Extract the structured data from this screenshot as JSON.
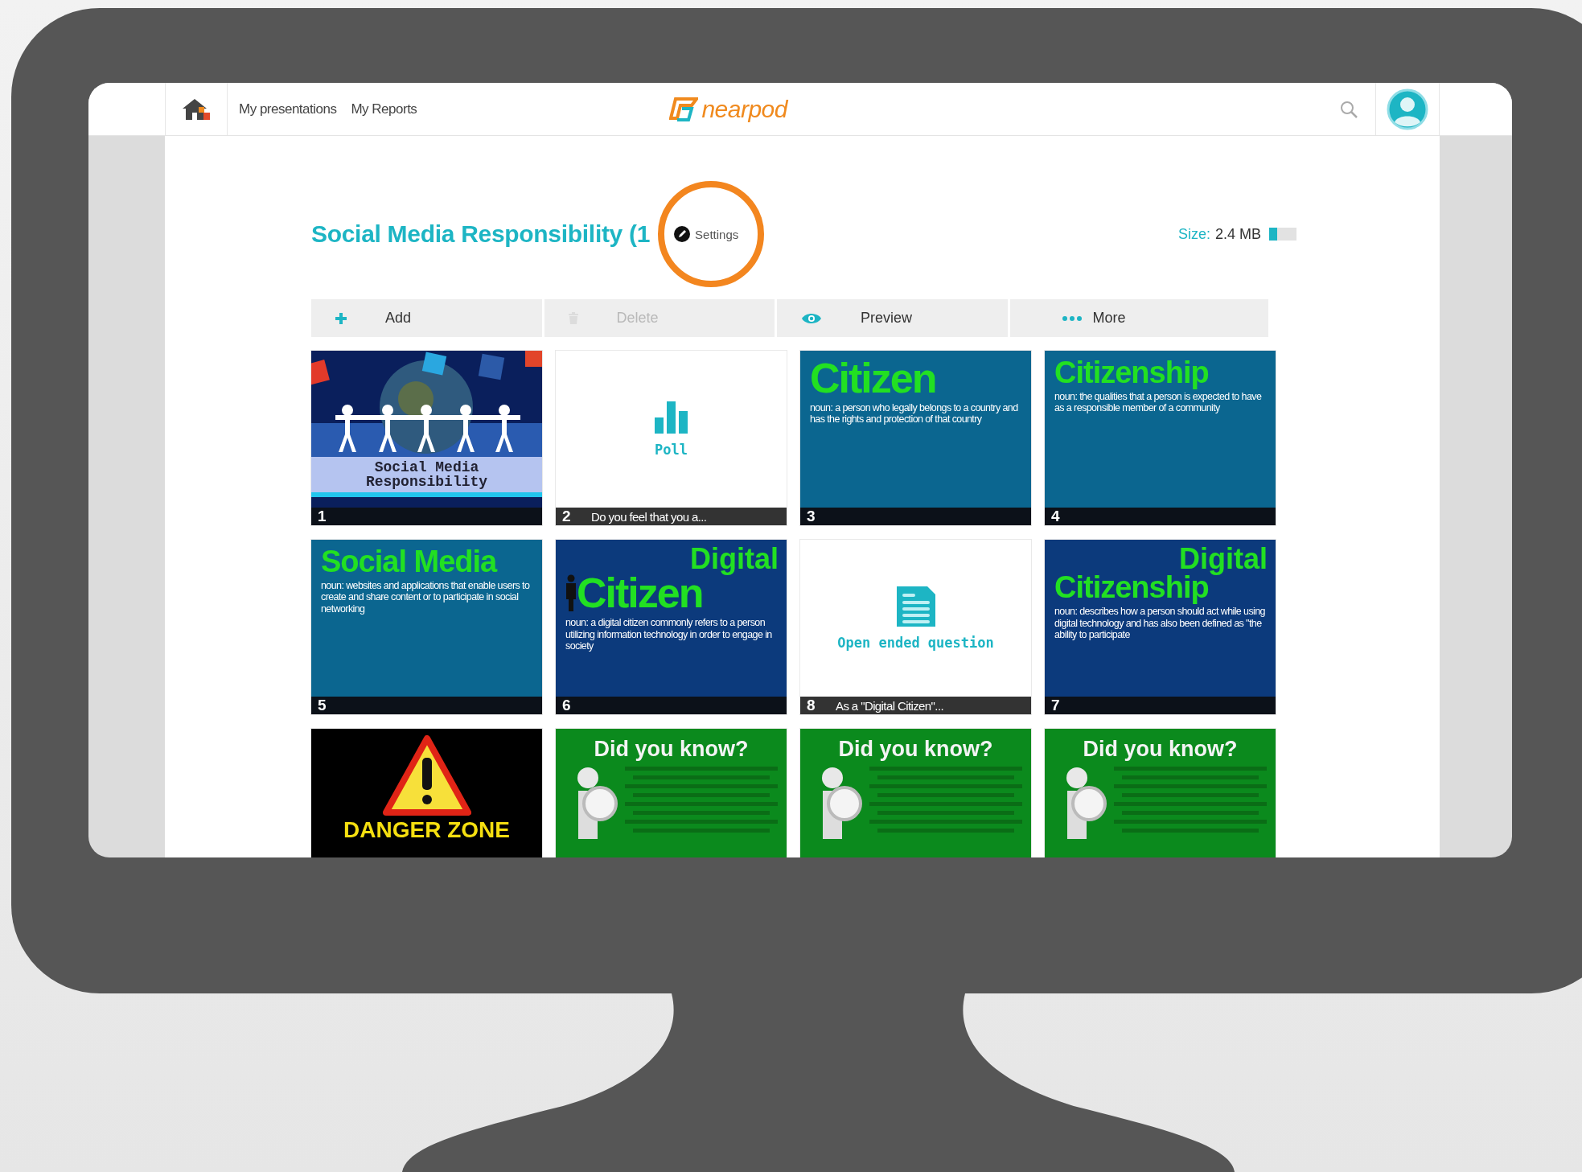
{
  "nav": {
    "links": [
      {
        "label": "My presentations"
      },
      {
        "label": "My Reports"
      }
    ],
    "logo": "nearpod"
  },
  "presentation": {
    "title": "Social Media Responsibility (1",
    "settings": "Settings",
    "size_label": "Size:",
    "size_value": "2.4 MB",
    "size_meter": {
      "level": 0.3
    }
  },
  "toolbar": [
    {
      "kind": "add",
      "label": "Add",
      "disabled": false
    },
    {
      "kind": "delete",
      "label": "Delete",
      "disabled": true
    },
    {
      "kind": "preview",
      "label": "Preview",
      "disabled": false
    },
    {
      "kind": "more",
      "label": "More",
      "disabled": false
    }
  ],
  "slides": [
    {
      "kind": "cover",
      "title": "Social Media Responsibility",
      "number": "1"
    },
    {
      "kind": "poll",
      "label": "Poll",
      "number": "2",
      "caption": "Do you feel that you a..."
    },
    {
      "kind": "definition",
      "color": "#0b6690",
      "heading": "Citizen",
      "body": "noun: a person who legally belongs to a country and has the rights and protection of that country",
      "number": "3"
    },
    {
      "kind": "definition",
      "color": "#0b6690",
      "heading": "Citizenship",
      "body": "noun: the qualities that a person is expected to have as a responsible member of a community",
      "number": "4"
    },
    {
      "kind": "definition",
      "color": "#0b6690",
      "heading": "Social Media",
      "body": "noun: websites and applications that enable users to create and share content or to participate in social networking",
      "number": "5"
    },
    {
      "kind": "definition",
      "color": "#0c3a7c",
      "pre_heading": "Digital",
      "heading": "Citizen",
      "body": "noun: a digital citizen commonly refers to a person utilizing information technology in order to engage in society",
      "number": "6"
    },
    {
      "kind": "question",
      "label": "Open ended question",
      "number": "8",
      "caption": "As a \"Digital Citizen\"..."
    },
    {
      "kind": "definition",
      "color": "#0c3a7c",
      "pre_heading": "Digital",
      "heading": "Citizenship",
      "body": "noun: describes how a person should act while using digital technology and has also been defined as \"the ability to participate",
      "number": "7"
    },
    {
      "kind": "warning",
      "heading": "DANGER ZONE"
    },
    {
      "kind": "fact",
      "heading": "Did you know?"
    },
    {
      "kind": "fact",
      "heading": "Did you know?"
    },
    {
      "kind": "fact",
      "heading": "Did you know?"
    }
  ]
}
